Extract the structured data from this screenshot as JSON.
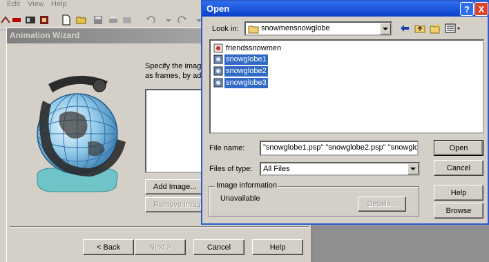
{
  "app": {
    "menu": [
      "Edit",
      "View",
      "Help"
    ]
  },
  "wizard": {
    "title": "Animation Wizard",
    "description_line1": "Specify the image",
    "description_line2": "as frames, by add",
    "add_image_label": "Add Image...",
    "remove_image_label": "Remove Image",
    "back_label": "< Back",
    "next_label": "Next >",
    "cancel_label": "Cancel",
    "help_label": "Help"
  },
  "open_dialog": {
    "title": "Open",
    "look_in_label": "Look in:",
    "look_in_value": "snowmensnowglobe",
    "files": [
      {
        "name": "friendssnowmen",
        "selected": false
      },
      {
        "name": "snowglobe1",
        "selected": true
      },
      {
        "name": "snowglobe2",
        "selected": true
      },
      {
        "name": "snowglobe3",
        "selected": true
      }
    ],
    "file_name_label": "File name:",
    "file_name_value": "\"snowglobe1.psp\" \"snowglobe2.psp\" \"snowglo",
    "files_of_type_label": "Files of type:",
    "files_of_type_value": "All Files",
    "image_info_label": "Image information",
    "image_info_value": "Unavailable",
    "details_label": "Details...",
    "open_label": "Open",
    "cancel_label": "Cancel",
    "help_label": "Help",
    "browse_label": "Browse",
    "help_caption": "?",
    "close_caption": "X"
  },
  "colors": {
    "title_bar_active": "#0a3fc8",
    "selection": "#316ac5",
    "dialog_face": "#d4d0c8"
  }
}
